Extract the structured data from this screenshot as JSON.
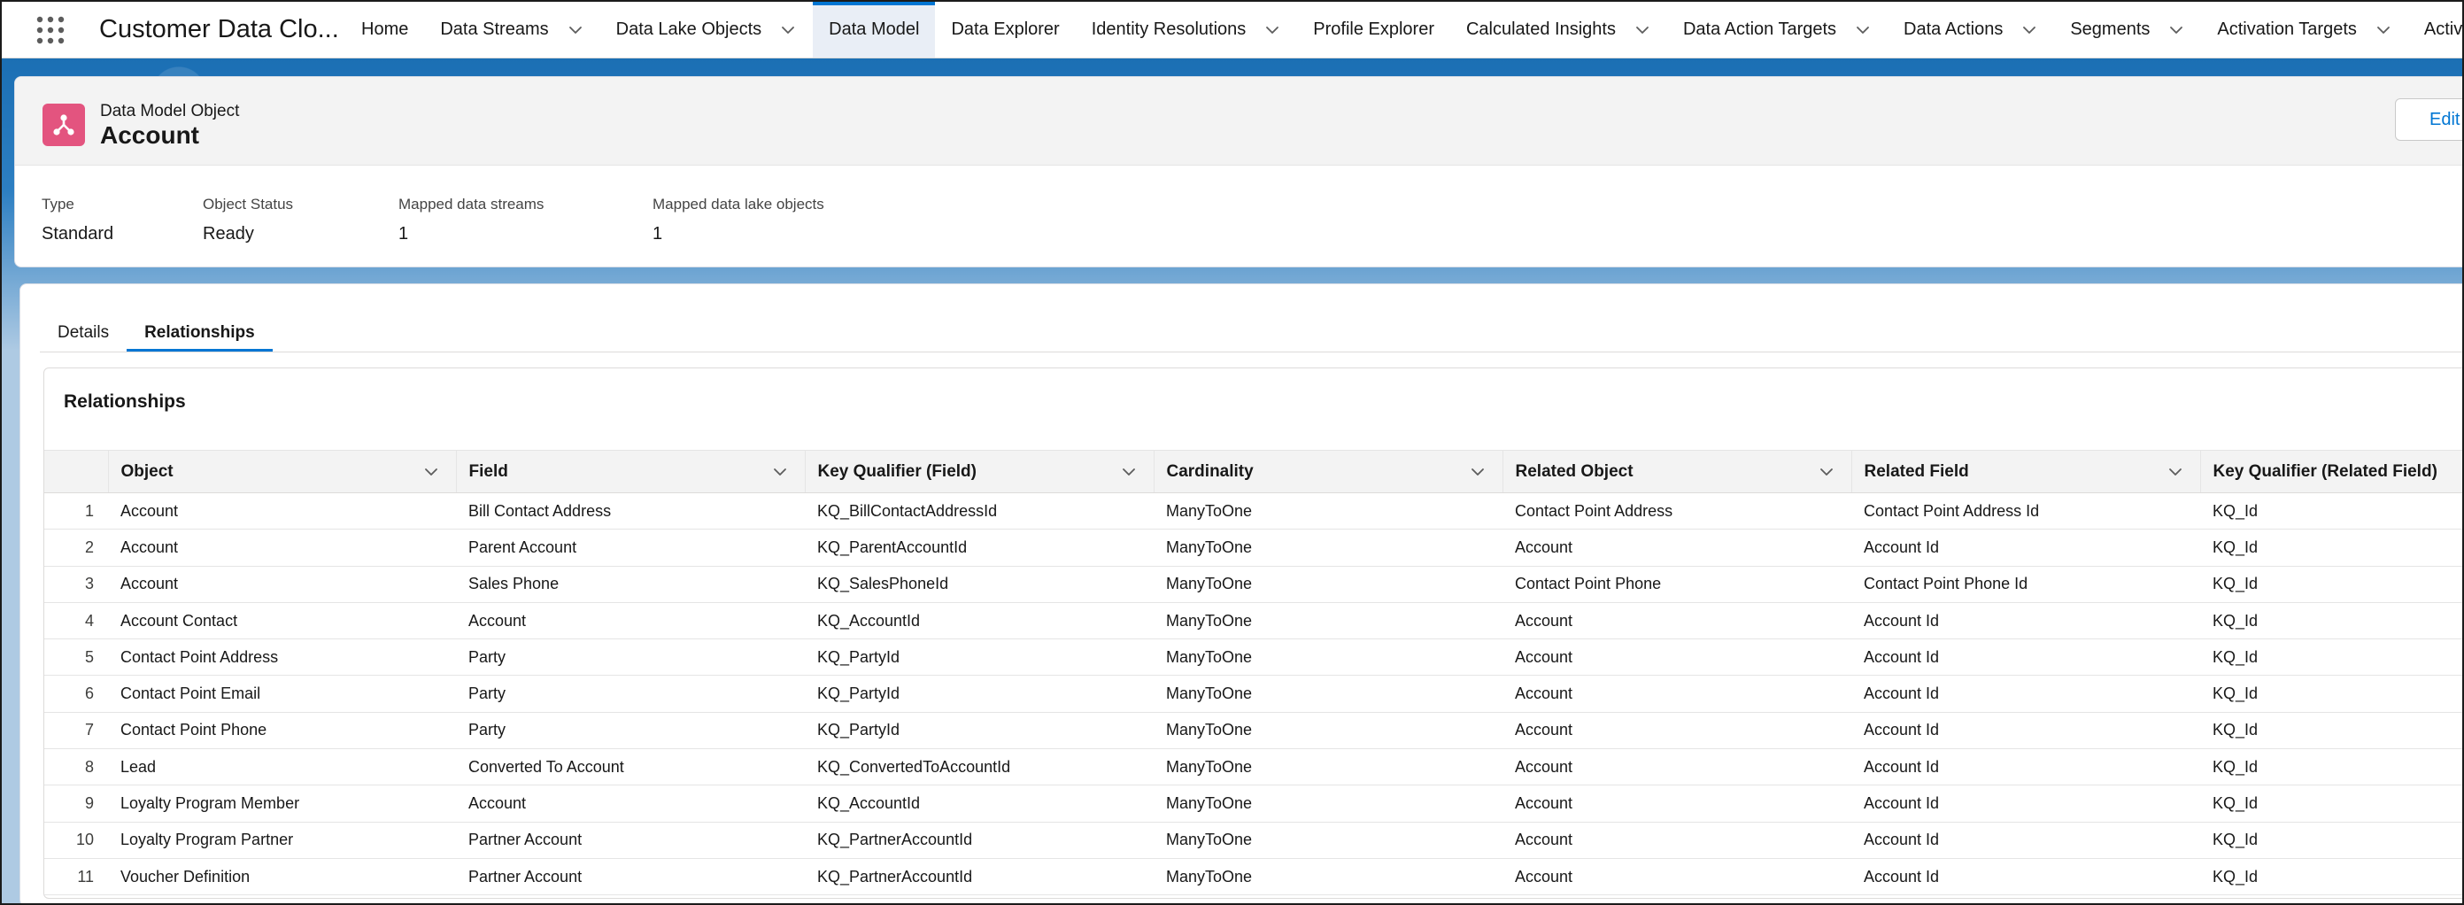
{
  "app": {
    "name": "Customer Data Clo..."
  },
  "nav": [
    {
      "label": "Home",
      "caret": false
    },
    {
      "label": "Data Streams",
      "caret": true
    },
    {
      "label": "Data Lake Objects",
      "caret": true
    },
    {
      "label": "Data Model",
      "caret": false,
      "active": true
    },
    {
      "label": "Data Explorer",
      "caret": false
    },
    {
      "label": "Identity Resolutions",
      "caret": true
    },
    {
      "label": "Profile Explorer",
      "caret": false
    },
    {
      "label": "Calculated Insights",
      "caret": true
    },
    {
      "label": "Data Action Targets",
      "caret": true
    },
    {
      "label": "Data Actions",
      "caret": true
    },
    {
      "label": "Segments",
      "caret": true
    },
    {
      "label": "Activation Targets",
      "caret": true
    },
    {
      "label": "Activa",
      "caret": false
    }
  ],
  "header": {
    "object_type": "Data Model Object",
    "object_name": "Account",
    "edit_label": "Edit",
    "icon": "data-model-icon",
    "icon_color": "#e3547f"
  },
  "meta": [
    {
      "label": "Type",
      "value": "Standard"
    },
    {
      "label": "Object Status",
      "value": "Ready"
    },
    {
      "label": "Mapped data streams",
      "value": "1"
    },
    {
      "label": "Mapped data lake objects",
      "value": "1"
    }
  ],
  "tabs": [
    {
      "label": "Details"
    },
    {
      "label": "Relationships",
      "active": true
    }
  ],
  "relationships": {
    "title": "Relationships",
    "columns": [
      {
        "label": "Object",
        "sortable": true
      },
      {
        "label": "Field",
        "sortable": true
      },
      {
        "label": "Key Qualifier (Field)",
        "sortable": true
      },
      {
        "label": "Cardinality",
        "sortable": true
      },
      {
        "label": "Related Object",
        "sortable": true
      },
      {
        "label": "Related Field",
        "sortable": true
      },
      {
        "label": "Key Qualifier (Related Field)",
        "sortable": false
      }
    ],
    "rows": [
      [
        "1",
        "Account",
        "Bill Contact Address",
        "KQ_BillContactAddressId",
        "ManyToOne",
        "Contact Point Address",
        "Contact Point Address Id",
        "KQ_Id"
      ],
      [
        "2",
        "Account",
        "Parent Account",
        "KQ_ParentAccountId",
        "ManyToOne",
        "Account",
        "Account Id",
        "KQ_Id"
      ],
      [
        "3",
        "Account",
        "Sales Phone",
        "KQ_SalesPhoneId",
        "ManyToOne",
        "Contact Point Phone",
        "Contact Point Phone Id",
        "KQ_Id"
      ],
      [
        "4",
        "Account Contact",
        "Account",
        "KQ_AccountId",
        "ManyToOne",
        "Account",
        "Account Id",
        "KQ_Id"
      ],
      [
        "5",
        "Contact Point Address",
        "Party",
        "KQ_PartyId",
        "ManyToOne",
        "Account",
        "Account Id",
        "KQ_Id"
      ],
      [
        "6",
        "Contact Point Email",
        "Party",
        "KQ_PartyId",
        "ManyToOne",
        "Account",
        "Account Id",
        "KQ_Id"
      ],
      [
        "7",
        "Contact Point Phone",
        "Party",
        "KQ_PartyId",
        "ManyToOne",
        "Account",
        "Account Id",
        "KQ_Id"
      ],
      [
        "8",
        "Lead",
        "Converted To Account",
        "KQ_ConvertedToAccountId",
        "ManyToOne",
        "Account",
        "Account Id",
        "KQ_Id"
      ],
      [
        "9",
        "Loyalty Program Member",
        "Account",
        "KQ_AccountId",
        "ManyToOne",
        "Account",
        "Account Id",
        "KQ_Id"
      ],
      [
        "10",
        "Loyalty Program Partner",
        "Partner Account",
        "KQ_PartnerAccountId",
        "ManyToOne",
        "Account",
        "Account Id",
        "KQ_Id"
      ],
      [
        "11",
        "Voucher Definition",
        "Partner Account",
        "KQ_PartnerAccountId",
        "ManyToOne",
        "Account",
        "Account Id",
        "KQ_Id"
      ]
    ]
  }
}
